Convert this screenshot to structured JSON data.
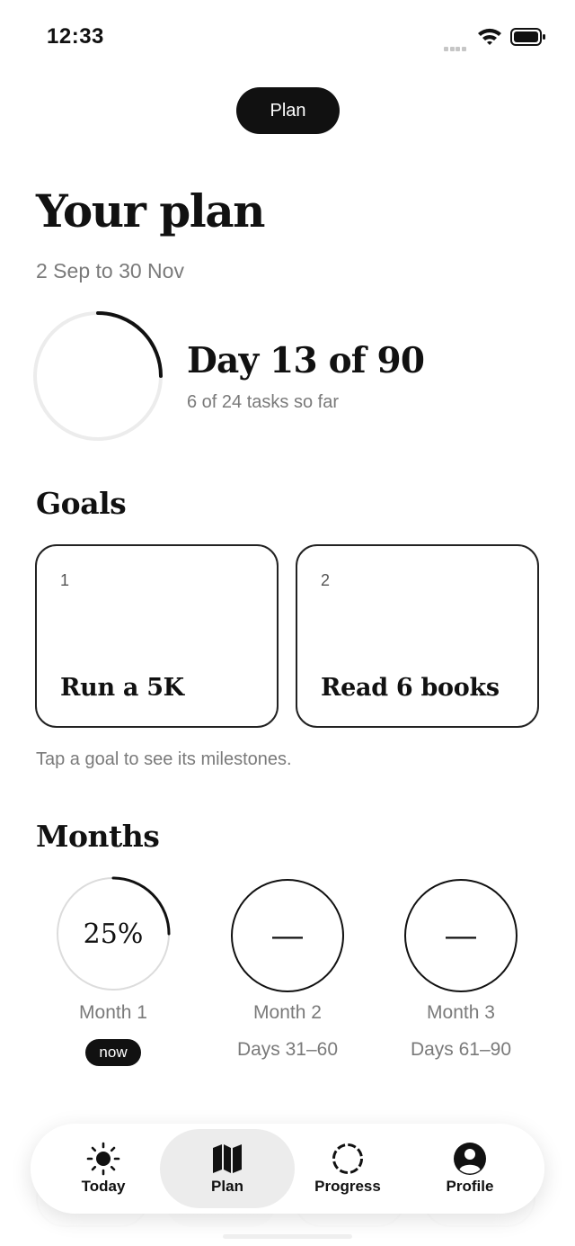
{
  "status_bar": {
    "time": "12:33"
  },
  "header": {
    "pill_label": "Plan"
  },
  "plan": {
    "title": "Your plan",
    "date_range": "2 Sep to 30 Nov",
    "day_label": "Day 13 of 90",
    "tasks_label": "6 of 24 tasks so far",
    "progress_fraction": 0.25
  },
  "goals": {
    "title": "Goals",
    "items": [
      {
        "number": "1",
        "name": "Run a 5K"
      },
      {
        "number": "2",
        "name": "Read 6 books"
      }
    ],
    "hint": "Tap a goal to see its milestones."
  },
  "months": {
    "title": "Months",
    "items": [
      {
        "value": "25%",
        "progress_fraction": 0.25,
        "name": "Month 1",
        "badge": "now"
      },
      {
        "value": "—",
        "name": "Month 2",
        "days": "Days 31–60"
      },
      {
        "value": "—",
        "name": "Month 3",
        "days": "Days 61–90"
      }
    ]
  },
  "nav": {
    "items": [
      {
        "label": "Today",
        "icon": "sun-icon"
      },
      {
        "label": "Plan",
        "icon": "map-icon",
        "active": true
      },
      {
        "label": "Progress",
        "icon": "dashed-circle-icon"
      },
      {
        "label": "Profile",
        "icon": "user-icon"
      }
    ]
  }
}
